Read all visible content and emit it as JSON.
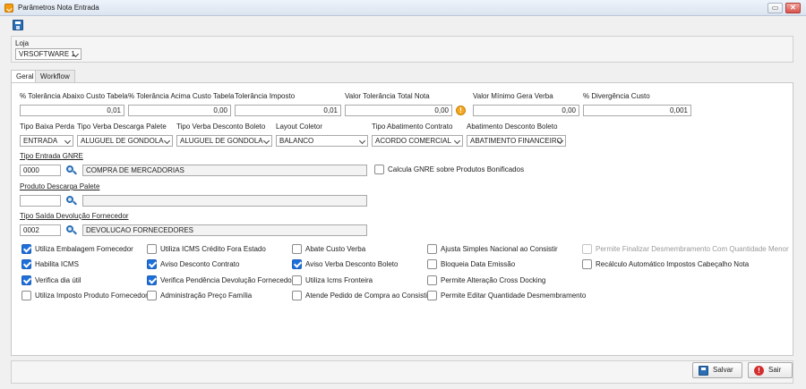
{
  "window": {
    "title": "Parâmetros Nota Entrada",
    "minimize": "▭",
    "close": "✕"
  },
  "loja": {
    "label": "Loja",
    "value": "VRSOFTWARE 1"
  },
  "tabs": [
    {
      "label": "Geral",
      "active": true
    },
    {
      "label": "Workflow",
      "active": false
    }
  ],
  "tolerances": [
    {
      "label": "% Tolerância Abaixo Custo Tabela",
      "value": "0,01"
    },
    {
      "label": "% Tolerância Acima Custo Tabela",
      "value": "0,00"
    },
    {
      "label": "Tolerância Imposto",
      "value": "0,01"
    },
    {
      "label": "Valor Tolerância Total Nota",
      "value": "0,00"
    },
    {
      "label": "Valor Mínimo Gera Verba",
      "value": "0,00"
    },
    {
      "label": "% Divergência Custo",
      "value": "0,001"
    }
  ],
  "warn_icon": "!",
  "dropdowns": [
    {
      "label": "Tipo Baixa Perda",
      "value": "ENTRADA"
    },
    {
      "label": "Tipo Verba Descarga Palete",
      "value": "ALUGUEL DE GONDOLA"
    },
    {
      "label": "Tipo Verba Desconto Boleto",
      "value": "ALUGUEL DE GONDOLA"
    },
    {
      "label": "Layout Coletor",
      "value": "BALANCO"
    },
    {
      "label": "Tipo Abatimento Contrato",
      "value": "ACORDO COMERCIAL"
    },
    {
      "label": "Abatimento Desconto Boleto",
      "value": "ABATIMENTO FINANCEIRO"
    }
  ],
  "tipo_entrada_gnre": {
    "label": "Tipo Entrada GNRE",
    "code": "0000",
    "description": "COMPRA DE MERCADORIAS"
  },
  "calcula_gnre": {
    "label": "Calcula GNRE sobre Produtos Bonificados",
    "checked": false
  },
  "produto_descarga_palete": {
    "label": "Produto Descarga Palete",
    "code": "",
    "description": ""
  },
  "tipo_saida_devolucao": {
    "label": "Tipo Saída Devolução Fornecedor",
    "code": "0002",
    "description": "DEVOLUCAO FORNECEDORES"
  },
  "checkboxes": [
    [
      {
        "label": "Utiliza Embalagem Fornecedor",
        "checked": true
      },
      {
        "label": "Habilita ICMS",
        "checked": true
      },
      {
        "label": "Verifica dia útil",
        "checked": true
      },
      {
        "label": "Utiliza Imposto Produto Fornecedor",
        "checked": false
      }
    ],
    [
      {
        "label": "Utiliza ICMS Crédito Fora Estado",
        "checked": false
      },
      {
        "label": "Aviso Desconto Contrato",
        "checked": true
      },
      {
        "label": "Verifica Pendência Devolução Fornecedor",
        "checked": true
      },
      {
        "label": "Administração Preço Família",
        "checked": false
      }
    ],
    [
      {
        "label": "Abate Custo Verba",
        "checked": false
      },
      {
        "label": "Aviso Verba Desconto Boleto",
        "checked": true
      },
      {
        "label": "Utiliza Icms Fronteira",
        "checked": false
      },
      {
        "label": "Atende Pedido de Compra ao Consistir",
        "checked": false
      }
    ],
    [
      {
        "label": "Ajusta Simples Nacional ao Consistir",
        "checked": false
      },
      {
        "label": "Bloqueia Data Emissão",
        "checked": false
      },
      {
        "label": "Permite Alteração Cross Docking",
        "checked": false
      },
      {
        "label": "Permite Editar Quantidade Desmembramento",
        "checked": false
      }
    ],
    [
      {
        "label": "Permite Finalizar Desmembramento Com Quantidade Menor",
        "checked": false,
        "disabled": true
      },
      {
        "label": "Recálculo Automático Impostos Cabeçalho Nota",
        "checked": false
      }
    ]
  ],
  "footer": {
    "save_label": "Salvar",
    "exit_label": "Sair"
  }
}
